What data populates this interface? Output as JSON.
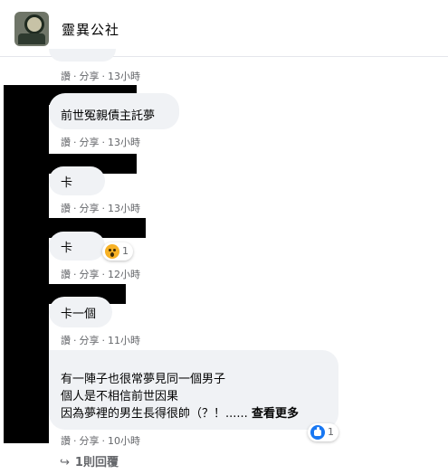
{
  "header": {
    "page_name": "靈異公社"
  },
  "comments": [
    {
      "lines": [],
      "meta": {
        "like": "讚",
        "share": "分享",
        "time": "13小時"
      }
    },
    {
      "lines": [
        "前世冤親債主託夢"
      ],
      "meta": {
        "like": "讚",
        "share": "分享",
        "time": "13小時"
      }
    },
    {
      "lines": [
        "卡"
      ],
      "meta": {
        "like": "讚",
        "share": "分享",
        "time": "13小時"
      }
    },
    {
      "lines": [
        "卡"
      ],
      "reaction": {
        "icon": "wow-emoji-icon",
        "count": "1"
      },
      "meta": {
        "like": "讚",
        "share": "分享",
        "time": "12小時"
      }
    },
    {
      "lines": [
        "卡一個"
      ],
      "meta": {
        "like": "讚",
        "share": "分享",
        "time": "11小時"
      }
    },
    {
      "lines": [
        "有一陣子也很常夢見同一個男子",
        "個人是不相信前世因果",
        "因為夢裡的男生長得很帥（？！......"
      ],
      "see_more": "查看更多",
      "reaction": {
        "icon": "like-icon",
        "count": "1"
      },
      "meta": {
        "like": "讚",
        "share": "分享",
        "time": "10小時"
      }
    }
  ],
  "replies": {
    "label": "1則回覆"
  },
  "colors": {
    "bubble": "#f0f2f5",
    "meta_text": "#65676b",
    "like_blue": "#1877f2",
    "wow_yellow": "#f7b125"
  }
}
